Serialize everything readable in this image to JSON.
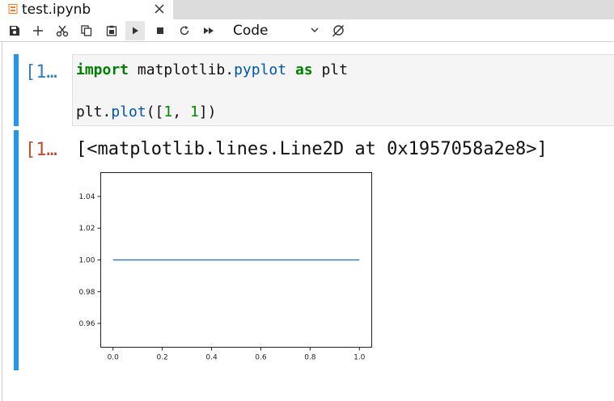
{
  "tab": {
    "title": "test.ipynb",
    "file_icon": "notebook-file-icon",
    "close_icon": "close-icon"
  },
  "toolbar": {
    "buttons": [
      "save-icon",
      "add-icon",
      "cut-icon",
      "copy-icon",
      "paste-icon",
      "run-icon",
      "stop-icon",
      "restart-icon",
      "fast-forward-icon"
    ],
    "cell_type": "Code",
    "kernel_icon": "kernel-status-icon"
  },
  "colors": {
    "active_cell_bar": "#2196f3",
    "input_prompt": "#307fc1",
    "output_prompt": "#c74a2c",
    "keyword": "#008000",
    "line": "#3a7ab0"
  },
  "cells": [
    {
      "input_prompt": "[1…",
      "code": {
        "line1": {
          "kw_import": "import",
          "module": " matplotlib.",
          "submodule": "pyplot",
          "kw_as": " as",
          "alias": " plt"
        },
        "line2": {
          "obj": "plt.",
          "func": "plot",
          "open": "([",
          "a": "1",
          "sep": ", ",
          "b": "1",
          "close": "])"
        }
      },
      "output_prompt": "[1…",
      "output_text": "[<matplotlib.lines.Line2D at 0x1957058a2e8>]"
    }
  ],
  "chart_data": {
    "type": "line",
    "x": [
      0.0,
      1.0
    ],
    "series": [
      {
        "values": [
          1,
          1
        ]
      }
    ],
    "xlim": [
      -0.05,
      1.05
    ],
    "ylim": [
      0.945,
      1.055
    ],
    "xticks": [
      "0.0",
      "0.2",
      "0.4",
      "0.6",
      "0.8",
      "1.0"
    ],
    "yticks": [
      "0.96",
      "0.98",
      "1.00",
      "1.02",
      "1.04"
    ],
    "grid": false
  }
}
